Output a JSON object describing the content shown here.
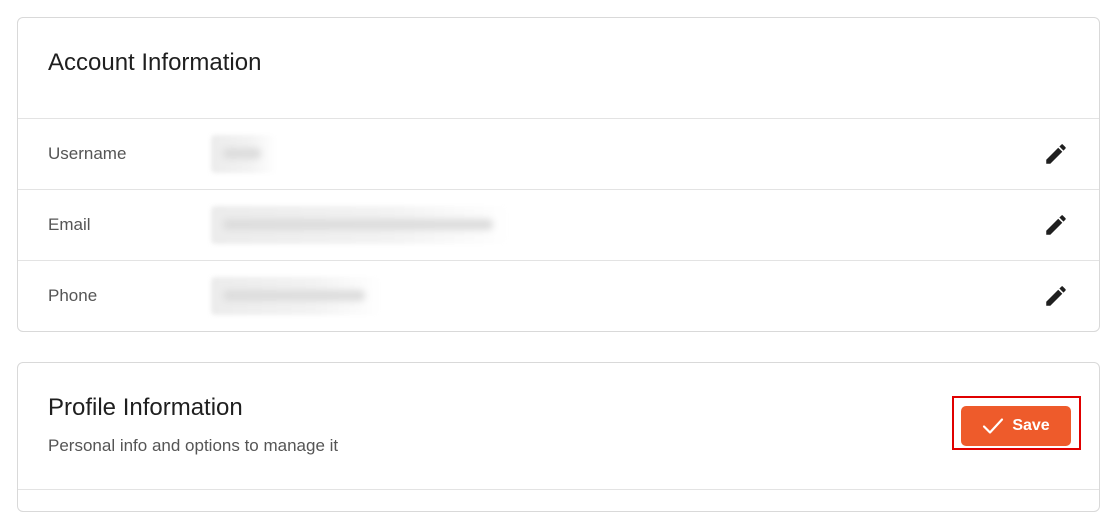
{
  "account": {
    "title": "Account Information",
    "rows": [
      {
        "label": "Username",
        "icon": "pencil-icon"
      },
      {
        "label": "Email",
        "icon": "pencil-icon"
      },
      {
        "label": "Phone",
        "icon": "pencil-icon"
      }
    ]
  },
  "profile": {
    "title": "Profile Information",
    "subtitle": "Personal info and options to manage it",
    "save_label": "Save",
    "save_icon": "checkmark-icon"
  },
  "colors": {
    "accent": "#ee5b2b",
    "highlight": "#e00000",
    "border": "#d9d9d9"
  }
}
